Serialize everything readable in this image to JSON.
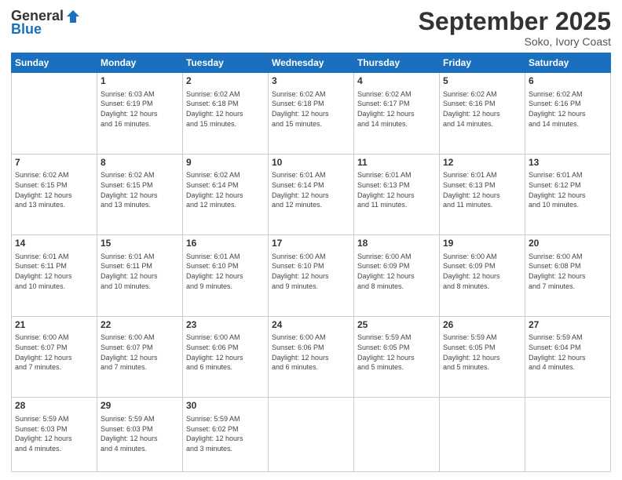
{
  "logo": {
    "general": "General",
    "blue": "Blue"
  },
  "header": {
    "title": "September 2025",
    "subtitle": "Soko, Ivory Coast"
  },
  "weekdays": [
    "Sunday",
    "Monday",
    "Tuesday",
    "Wednesday",
    "Thursday",
    "Friday",
    "Saturday"
  ],
  "weeks": [
    [
      {
        "day": "",
        "info": ""
      },
      {
        "day": "1",
        "info": "Sunrise: 6:03 AM\nSunset: 6:19 PM\nDaylight: 12 hours\nand 16 minutes."
      },
      {
        "day": "2",
        "info": "Sunrise: 6:02 AM\nSunset: 6:18 PM\nDaylight: 12 hours\nand 15 minutes."
      },
      {
        "day": "3",
        "info": "Sunrise: 6:02 AM\nSunset: 6:18 PM\nDaylight: 12 hours\nand 15 minutes."
      },
      {
        "day": "4",
        "info": "Sunrise: 6:02 AM\nSunset: 6:17 PM\nDaylight: 12 hours\nand 14 minutes."
      },
      {
        "day": "5",
        "info": "Sunrise: 6:02 AM\nSunset: 6:16 PM\nDaylight: 12 hours\nand 14 minutes."
      },
      {
        "day": "6",
        "info": "Sunrise: 6:02 AM\nSunset: 6:16 PM\nDaylight: 12 hours\nand 14 minutes."
      }
    ],
    [
      {
        "day": "7",
        "info": "Sunrise: 6:02 AM\nSunset: 6:15 PM\nDaylight: 12 hours\nand 13 minutes."
      },
      {
        "day": "8",
        "info": "Sunrise: 6:02 AM\nSunset: 6:15 PM\nDaylight: 12 hours\nand 13 minutes."
      },
      {
        "day": "9",
        "info": "Sunrise: 6:02 AM\nSunset: 6:14 PM\nDaylight: 12 hours\nand 12 minutes."
      },
      {
        "day": "10",
        "info": "Sunrise: 6:01 AM\nSunset: 6:14 PM\nDaylight: 12 hours\nand 12 minutes."
      },
      {
        "day": "11",
        "info": "Sunrise: 6:01 AM\nSunset: 6:13 PM\nDaylight: 12 hours\nand 11 minutes."
      },
      {
        "day": "12",
        "info": "Sunrise: 6:01 AM\nSunset: 6:13 PM\nDaylight: 12 hours\nand 11 minutes."
      },
      {
        "day": "13",
        "info": "Sunrise: 6:01 AM\nSunset: 6:12 PM\nDaylight: 12 hours\nand 10 minutes."
      }
    ],
    [
      {
        "day": "14",
        "info": "Sunrise: 6:01 AM\nSunset: 6:11 PM\nDaylight: 12 hours\nand 10 minutes."
      },
      {
        "day": "15",
        "info": "Sunrise: 6:01 AM\nSunset: 6:11 PM\nDaylight: 12 hours\nand 10 minutes."
      },
      {
        "day": "16",
        "info": "Sunrise: 6:01 AM\nSunset: 6:10 PM\nDaylight: 12 hours\nand 9 minutes."
      },
      {
        "day": "17",
        "info": "Sunrise: 6:00 AM\nSunset: 6:10 PM\nDaylight: 12 hours\nand 9 minutes."
      },
      {
        "day": "18",
        "info": "Sunrise: 6:00 AM\nSunset: 6:09 PM\nDaylight: 12 hours\nand 8 minutes."
      },
      {
        "day": "19",
        "info": "Sunrise: 6:00 AM\nSunset: 6:09 PM\nDaylight: 12 hours\nand 8 minutes."
      },
      {
        "day": "20",
        "info": "Sunrise: 6:00 AM\nSunset: 6:08 PM\nDaylight: 12 hours\nand 7 minutes."
      }
    ],
    [
      {
        "day": "21",
        "info": "Sunrise: 6:00 AM\nSunset: 6:07 PM\nDaylight: 12 hours\nand 7 minutes."
      },
      {
        "day": "22",
        "info": "Sunrise: 6:00 AM\nSunset: 6:07 PM\nDaylight: 12 hours\nand 7 minutes."
      },
      {
        "day": "23",
        "info": "Sunrise: 6:00 AM\nSunset: 6:06 PM\nDaylight: 12 hours\nand 6 minutes."
      },
      {
        "day": "24",
        "info": "Sunrise: 6:00 AM\nSunset: 6:06 PM\nDaylight: 12 hours\nand 6 minutes."
      },
      {
        "day": "25",
        "info": "Sunrise: 5:59 AM\nSunset: 6:05 PM\nDaylight: 12 hours\nand 5 minutes."
      },
      {
        "day": "26",
        "info": "Sunrise: 5:59 AM\nSunset: 6:05 PM\nDaylight: 12 hours\nand 5 minutes."
      },
      {
        "day": "27",
        "info": "Sunrise: 5:59 AM\nSunset: 6:04 PM\nDaylight: 12 hours\nand 4 minutes."
      }
    ],
    [
      {
        "day": "28",
        "info": "Sunrise: 5:59 AM\nSunset: 6:03 PM\nDaylight: 12 hours\nand 4 minutes."
      },
      {
        "day": "29",
        "info": "Sunrise: 5:59 AM\nSunset: 6:03 PM\nDaylight: 12 hours\nand 4 minutes."
      },
      {
        "day": "30",
        "info": "Sunrise: 5:59 AM\nSunset: 6:02 PM\nDaylight: 12 hours\nand 3 minutes."
      },
      {
        "day": "",
        "info": ""
      },
      {
        "day": "",
        "info": ""
      },
      {
        "day": "",
        "info": ""
      },
      {
        "day": "",
        "info": ""
      }
    ]
  ]
}
